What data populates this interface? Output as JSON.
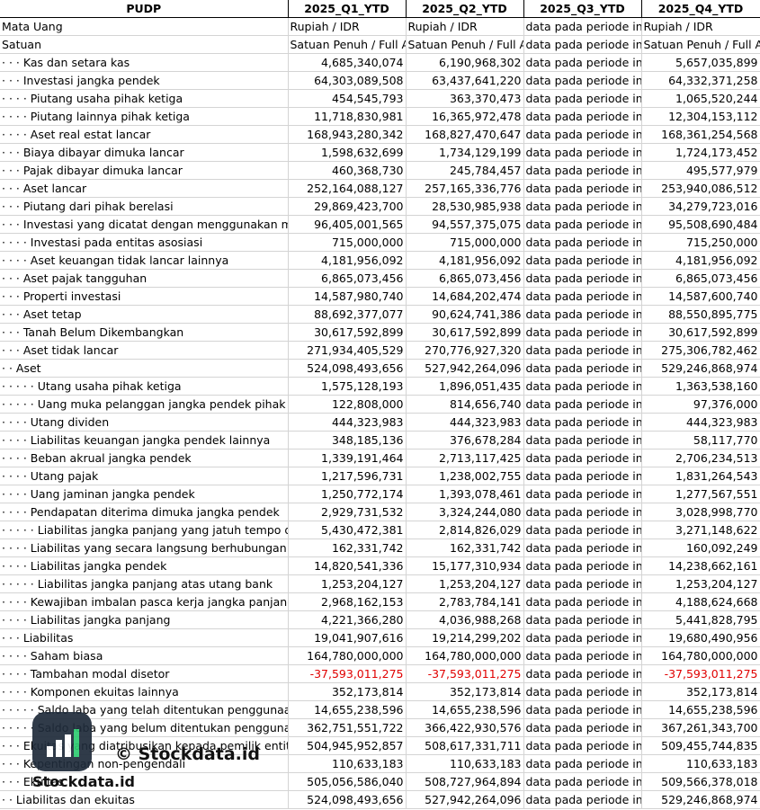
{
  "header": [
    "PUDP",
    "2025_Q1_YTD",
    "2025_Q2_YTD",
    "2025_Q3_YTD",
    "2025_Q4_YTD"
  ],
  "rows": [
    {
      "label": "Mata Uang",
      "v": [
        "Rupiah / IDR",
        "Rupiah / IDR",
        "data pada periode ini tidak tersedia",
        "Rupiah / IDR"
      ],
      "kind": "txt"
    },
    {
      "label": "Satuan",
      "v": [
        "Satuan Penuh / Full Amount",
        "Satuan Penuh / Full Amount",
        "data pada periode ini tidak tersedia",
        "Satuan Penuh / Full Amount"
      ],
      "kind": "txt"
    },
    {
      "label": "· · · Kas dan setara kas",
      "v": [
        "4,685,340,074",
        "6,190,968,302",
        "data pada periode ini tidak tersedia",
        "5,657,035,899"
      ]
    },
    {
      "label": "· · · Investasi jangka pendek",
      "v": [
        "64,303,089,508",
        "63,437,641,220",
        "data pada periode ini tidak tersedia",
        "64,332,371,258"
      ]
    },
    {
      "label": "· · · · Piutang usaha pihak ketiga",
      "v": [
        "454,545,793",
        "363,370,473",
        "data pada periode ini tidak tersedia",
        "1,065,520,244"
      ]
    },
    {
      "label": "· · · · Piutang lainnya pihak ketiga",
      "v": [
        "11,718,830,981",
        "16,365,972,478",
        "data pada periode ini tidak tersedia",
        "12,304,153,112"
      ]
    },
    {
      "label": "· · · · Aset real estat lancar",
      "v": [
        "168,943,280,342",
        "168,827,470,647",
        "data pada periode ini tidak tersedia",
        "168,361,254,568"
      ]
    },
    {
      "label": "· · · Biaya dibayar dimuka lancar",
      "v": [
        "1,598,632,699",
        "1,734,129,199",
        "data pada periode ini tidak tersedia",
        "1,724,173,452"
      ]
    },
    {
      "label": "· · · Pajak dibayar dimuka lancar",
      "v": [
        "460,368,730",
        "245,784,457",
        "data pada periode ini tidak tersedia",
        "495,577,979"
      ]
    },
    {
      "label": "· · · Aset lancar",
      "v": [
        "252,164,088,127",
        "257,165,336,776",
        "data pada periode ini tidak tersedia",
        "253,940,086,512"
      ]
    },
    {
      "label": "· · · Piutang dari pihak berelasi",
      "v": [
        "29,869,423,700",
        "28,530,985,938",
        "data pada periode ini tidak tersedia",
        "34,279,723,016"
      ]
    },
    {
      "label": "· · · Investasi yang dicatat dengan menggunakan metode ekuitas",
      "v": [
        "96,405,001,565",
        "94,557,375,075",
        "data pada periode ini tidak tersedia",
        "95,508,690,484"
      ]
    },
    {
      "label": "· · · · Investasi pada entitas asosiasi",
      "v": [
        "715,000,000",
        "715,000,000",
        "data pada periode ini tidak tersedia",
        "715,250,000"
      ]
    },
    {
      "label": "· · · · Aset keuangan tidak lancar lainnya",
      "v": [
        "4,181,956,092",
        "4,181,956,092",
        "data pada periode ini tidak tersedia",
        "4,181,956,092"
      ]
    },
    {
      "label": "· · · Aset pajak tangguhan",
      "v": [
        "6,865,073,456",
        "6,865,073,456",
        "data pada periode ini tidak tersedia",
        "6,865,073,456"
      ]
    },
    {
      "label": "· · · Properti investasi",
      "v": [
        "14,587,980,740",
        "14,684,202,474",
        "data pada periode ini tidak tersedia",
        "14,587,600,740"
      ]
    },
    {
      "label": "· · · Aset tetap",
      "v": [
        "88,692,377,077",
        "90,624,741,386",
        "data pada periode ini tidak tersedia",
        "88,550,895,775"
      ]
    },
    {
      "label": "· · · Tanah Belum Dikembangkan",
      "v": [
        "30,617,592,899",
        "30,617,592,899",
        "data pada periode ini tidak tersedia",
        "30,617,592,899"
      ]
    },
    {
      "label": "· · · Aset tidak lancar",
      "v": [
        "271,934,405,529",
        "270,776,927,320",
        "data pada periode ini tidak tersedia",
        "275,306,782,462"
      ]
    },
    {
      "label": "· · Aset",
      "v": [
        "524,098,493,656",
        "527,942,264,096",
        "data pada periode ini tidak tersedia",
        "529,246,868,974"
      ]
    },
    {
      "label": "· · · · · Utang usaha pihak ketiga",
      "v": [
        "1,575,128,193",
        "1,896,051,435",
        "data pada periode ini tidak tersedia",
        "1,363,538,160"
      ]
    },
    {
      "label": "· · · · · Uang muka pelanggan jangka pendek pihak ketiga",
      "v": [
        "122,808,000",
        "814,656,740",
        "data pada periode ini tidak tersedia",
        "97,376,000"
      ]
    },
    {
      "label": "· · · · Utang dividen",
      "v": [
        "444,323,983",
        "444,323,983",
        "data pada periode ini tidak tersedia",
        "444,323,983"
      ]
    },
    {
      "label": "· · · · Liabilitas keuangan jangka pendek lainnya",
      "v": [
        "348,185,136",
        "376,678,284",
        "data pada periode ini tidak tersedia",
        "58,117,770"
      ]
    },
    {
      "label": "· · · · Beban akrual jangka pendek",
      "v": [
        "1,339,191,464",
        "2,713,117,425",
        "data pada periode ini tidak tersedia",
        "2,706,234,513"
      ]
    },
    {
      "label": "· · · · Utang pajak",
      "v": [
        "1,217,596,731",
        "1,238,002,755",
        "data pada periode ini tidak tersedia",
        "1,831,264,543"
      ]
    },
    {
      "label": "· · · · Uang jaminan jangka pendek",
      "v": [
        "1,250,772,174",
        "1,393,078,461",
        "data pada periode ini tidak tersedia",
        "1,277,567,551"
      ]
    },
    {
      "label": "· · · · Pendapatan diterima dimuka jangka pendek",
      "v": [
        "2,929,731,532",
        "3,324,244,080",
        "data pada periode ini tidak tersedia",
        "3,028,998,770"
      ]
    },
    {
      "label": "· · · · · Liabilitas jangka panjang yang jatuh tempo dalam satu tahun",
      "v": [
        "5,430,472,381",
        "2,814,826,029",
        "data pada periode ini tidak tersedia",
        "3,271,148,622"
      ]
    },
    {
      "label": "· · · · Liabilitas yang secara langsung berhubungan dengan aset",
      "v": [
        "162,331,742",
        "162,331,742",
        "data pada periode ini tidak tersedia",
        "160,092,249"
      ]
    },
    {
      "label": "· · · · Liabilitas jangka pendek",
      "v": [
        "14,820,541,336",
        "15,177,310,934",
        "data pada periode ini tidak tersedia",
        "14,238,662,161"
      ]
    },
    {
      "label": "· · · · · Liabilitas jangka panjang atas utang bank",
      "v": [
        "1,253,204,127",
        "1,253,204,127",
        "data pada periode ini tidak tersedia",
        "1,253,204,127"
      ]
    },
    {
      "label": "· · · · Kewajiban imbalan pasca kerja jangka panjang",
      "v": [
        "2,968,162,153",
        "2,783,784,141",
        "data pada periode ini tidak tersedia",
        "4,188,624,668"
      ]
    },
    {
      "label": "· · · · Liabilitas jangka panjang",
      "v": [
        "4,221,366,280",
        "4,036,988,268",
        "data pada periode ini tidak tersedia",
        "5,441,828,795"
      ]
    },
    {
      "label": "· · · Liabilitas",
      "v": [
        "19,041,907,616",
        "19,214,299,202",
        "data pada periode ini tidak tersedia",
        "19,680,490,956"
      ]
    },
    {
      "label": "· · · · Saham biasa",
      "v": [
        "164,780,000,000",
        "164,780,000,000",
        "data pada periode ini tidak tersedia",
        "164,780,000,000"
      ]
    },
    {
      "label": "· · · · Tambahan modal disetor",
      "v": [
        "-37,593,011,275",
        "-37,593,011,275",
        "data pada periode ini tidak tersedia",
        "-37,593,011,275"
      ],
      "neg": true
    },
    {
      "label": "· · · · Komponen ekuitas lainnya",
      "v": [
        "352,173,814",
        "352,173,814",
        "data pada periode ini tidak tersedia",
        "352,173,814"
      ]
    },
    {
      "label": "· · · · · Saldo laba yang telah ditentukan penggunaannya",
      "v": [
        "14,655,238,596",
        "14,655,238,596",
        "data pada periode ini tidak tersedia",
        "14,655,238,596"
      ]
    },
    {
      "label": "· · · · · Saldo laba yang belum ditentukan penggunaannya",
      "v": [
        "362,751,551,722",
        "366,422,930,576",
        "data pada periode ini tidak tersedia",
        "367,261,343,700"
      ]
    },
    {
      "label": "· · · Ekuitas yang diatribusikan kepada pemilik entitas induk",
      "v": [
        "504,945,952,857",
        "508,617,331,711",
        "data pada periode ini tidak tersedia",
        "509,455,744,835"
      ]
    },
    {
      "label": "· · · Kepentingan non-pengendali",
      "v": [
        "110,633,183",
        "110,633,183",
        "data pada periode ini tidak tersedia",
        "110,633,183"
      ]
    },
    {
      "label": "· · · Ekuitas",
      "v": [
        "505,056,586,040",
        "508,727,964,894",
        "data pada periode ini tidak tersedia",
        "509,566,378,018"
      ]
    },
    {
      "label": "· · Liabilitas dan ekuitas",
      "v": [
        "524,098,493,656",
        "527,942,264,096",
        "data pada periode ini tidak tersedia",
        "529,246,868,974"
      ]
    }
  ],
  "watermark": {
    "copyright": "© Stockdata.id",
    "brand": "Stockdata.id"
  }
}
